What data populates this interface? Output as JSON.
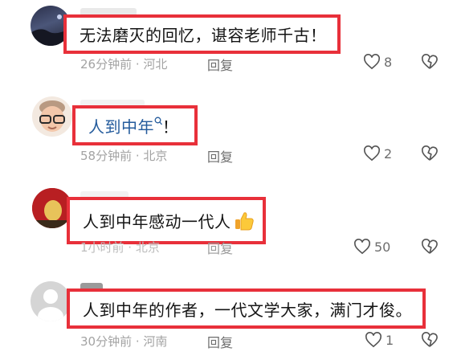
{
  "comments": [
    {
      "text": "无法磨灭的回忆，谌容老师千古！",
      "meta": "26分钟前 · 河北",
      "reply_label": "回复",
      "likes": "8",
      "avatar": "night-sky-photo"
    },
    {
      "text_prefix": "人到中年",
      "text_suffix": "！",
      "meta": "58分钟前 · 北京",
      "reply_label": "回复",
      "likes": "2",
      "avatar": "cartoon-glasses-man"
    },
    {
      "text": "人到中年感动一代人",
      "emoji": "thumbs-up-icon",
      "meta": "1小时前 · 北京",
      "reply_label": "回复",
      "likes": "50",
      "avatar": "red-photo"
    },
    {
      "text": "人到中年的作者，一代文学大家，满门才俊。",
      "meta": "30分钟前 · 河南",
      "reply_label": "回复",
      "likes": "1",
      "avatar": "default-gray-avatar"
    }
  ],
  "colors": {
    "highlight_border": "#e8303a",
    "link_blue": "#245b9c"
  }
}
